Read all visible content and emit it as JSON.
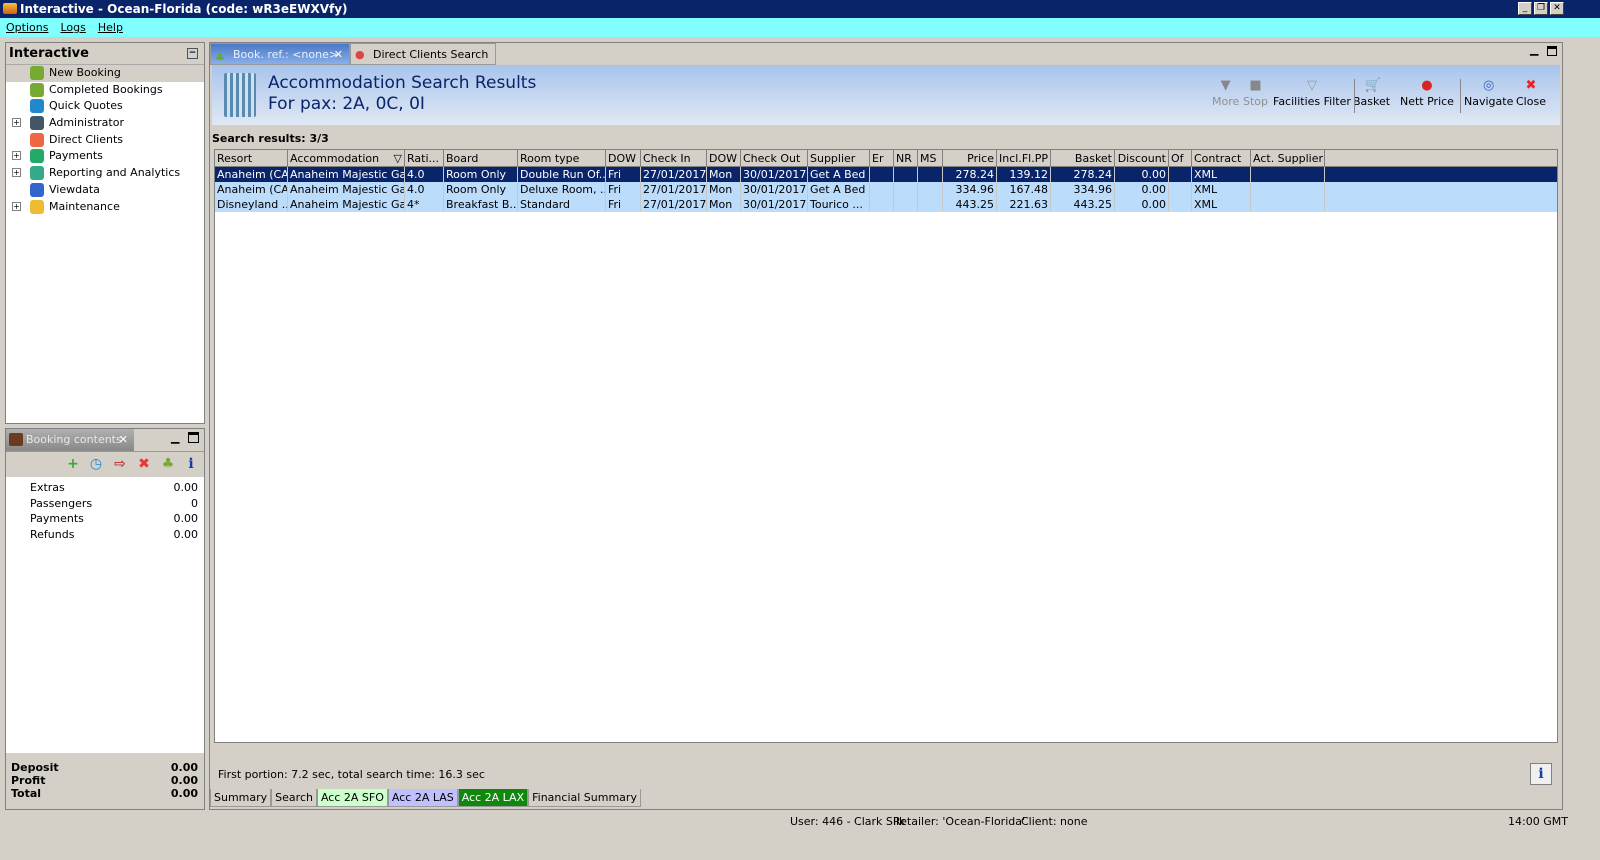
{
  "window": {
    "title": "Interactive - Ocean-Florida (code: wR3eEWXVfy)"
  },
  "menu": [
    "Options",
    "Logs",
    "Help"
  ],
  "left_panel": {
    "title": "Interactive",
    "items": [
      {
        "label": "New Booking",
        "expandable": false,
        "icon": "palm-island-icon"
      },
      {
        "label": "Completed Bookings",
        "expandable": false,
        "icon": "palm-island-icon"
      },
      {
        "label": "Quick Quotes",
        "expandable": false,
        "icon": "clock-icon"
      },
      {
        "label": "Administrator",
        "expandable": true,
        "icon": "person-icon"
      },
      {
        "label": "Direct Clients",
        "expandable": false,
        "icon": "client-icon"
      },
      {
        "label": "Payments",
        "expandable": true,
        "icon": "payments-icon"
      },
      {
        "label": "Reporting and Analytics",
        "expandable": true,
        "icon": "report-icon"
      },
      {
        "label": "Viewdata",
        "expandable": false,
        "icon": "globe-icon"
      },
      {
        "label": "Maintenance",
        "expandable": true,
        "icon": "toolbox-icon"
      }
    ]
  },
  "booking_panel": {
    "tab": "Booking contents",
    "rows": [
      {
        "label": "Extras",
        "value": "0.00"
      },
      {
        "label": "Passengers",
        "value": "0"
      },
      {
        "label": "Payments",
        "value": "0.00"
      },
      {
        "label": "Refunds",
        "value": "0.00"
      }
    ],
    "footer": [
      {
        "label": "Deposit",
        "value": "0.00"
      },
      {
        "label": "Profit",
        "value": "0.00"
      },
      {
        "label": "Total",
        "value": "0.00"
      }
    ]
  },
  "tabs": [
    {
      "label": "Book. ref.: <none>",
      "active": true
    },
    {
      "label": "Direct Clients Search",
      "active": false
    }
  ],
  "header": {
    "title": "Accommodation Search Results",
    "subtitle": "For pax: 2A, 0C, 0I"
  },
  "toolbar": [
    {
      "label": "More",
      "enabled": false,
      "icon": "triangle-down-icon"
    },
    {
      "label": "Stop",
      "enabled": false,
      "icon": "stop-icon"
    },
    {
      "label": "Facilities Filter",
      "enabled": true,
      "icon": "funnel-icon"
    },
    {
      "label": "Basket",
      "enabled": true,
      "icon": "cart-icon"
    },
    {
      "label": "Nett Price",
      "enabled": true,
      "icon": "berries-icon"
    },
    {
      "label": "Navigate",
      "enabled": true,
      "icon": "compass-icon"
    },
    {
      "label": "Close",
      "enabled": true,
      "icon": "close-icon"
    }
  ],
  "results": {
    "label": "Search results: 3/3",
    "columns": [
      "Resort",
      "Accommodation",
      "Rati...",
      "Board",
      "Room type",
      "DOW",
      "Check In",
      "DOW",
      "Check Out",
      "Supplier",
      "Er",
      "NR",
      "MS",
      "Price",
      "Incl.Fl.PP",
      "Basket",
      "Discount",
      "Of",
      "Contract",
      "Act. Supplier"
    ],
    "rows": [
      [
        "Anaheim (CA)",
        "Anaheim Majestic Ga...",
        "4.0",
        "Room Only",
        "Double Run Of...",
        "Fri",
        "27/01/2017",
        "Mon",
        "30/01/2017",
        "Get A Bed",
        "",
        "",
        "",
        "278.24",
        "139.12",
        "278.24",
        "0.00",
        "",
        "XML",
        ""
      ],
      [
        "Anaheim (CA)",
        "Anaheim Majestic Ga...",
        "4.0",
        "Room Only",
        "Deluxe Room, ...",
        "Fri",
        "27/01/2017",
        "Mon",
        "30/01/2017",
        "Get A Bed",
        "",
        "",
        "",
        "334.96",
        "167.48",
        "334.96",
        "0.00",
        "",
        "XML",
        ""
      ],
      [
        "Disneyland ...",
        "Anaheim Majestic Ga...",
        "4*",
        "Breakfast B...",
        "Standard",
        "Fri",
        "27/01/2017",
        "Mon",
        "30/01/2017",
        "Tourico ...",
        "",
        "",
        "",
        "443.25",
        "221.63",
        "443.25",
        "0.00",
        "",
        "XML",
        ""
      ]
    ],
    "selected_row": 0
  },
  "timing": "First portion: 7.2 sec, total search time: 16.3 sec",
  "bottom_tabs": [
    {
      "label": "Summary",
      "color": "#d4d0c8",
      "text": "#000000"
    },
    {
      "label": "Search",
      "color": "#d4d0c8",
      "text": "#000000"
    },
    {
      "label": "Acc 2A SFO",
      "color": "#ccffcc",
      "text": "#000000"
    },
    {
      "label": "Acc 2A LAS",
      "color": "#c0c0ff",
      "text": "#000000"
    },
    {
      "label": "Acc 2A LAX",
      "color": "#108810",
      "text": "#ffffff"
    },
    {
      "label": "Financial Summary",
      "color": "#d4d0c8",
      "text": "#000000"
    }
  ],
  "status": {
    "user": "User: 446 - Clark Silk",
    "retailer": "Retailer: 'Ocean-Florida'",
    "client": "Client: none",
    "time": "14:00 GMT"
  }
}
